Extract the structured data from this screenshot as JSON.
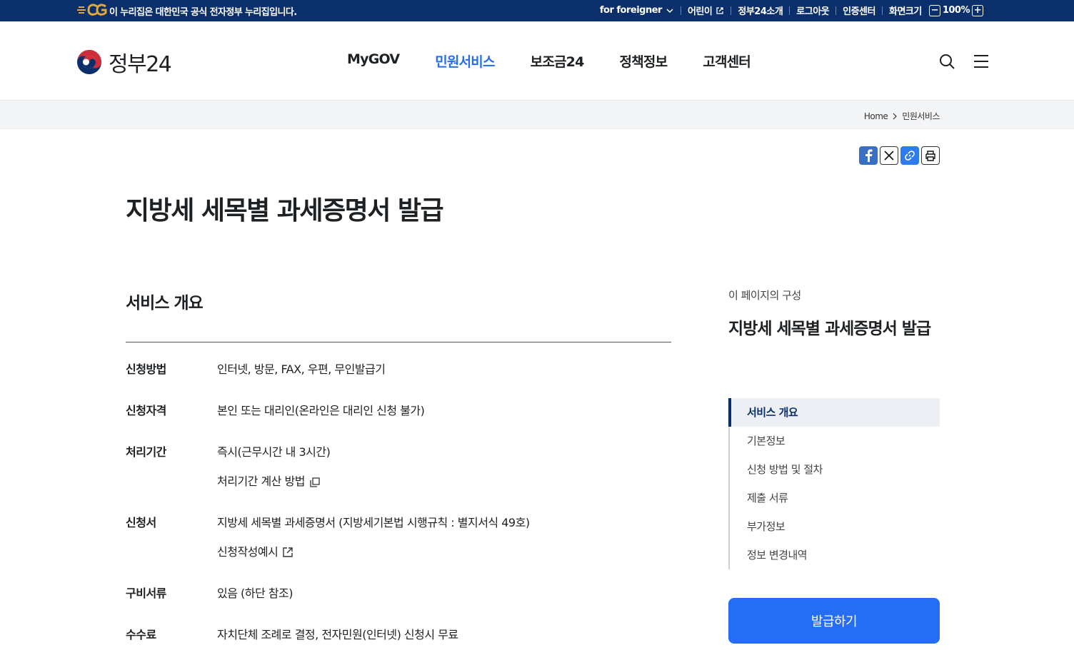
{
  "topbar": {
    "notice": "이 누리집은 대한민국 공식 전자정부 누리집입니다.",
    "links": {
      "foreigner": "for foreigner",
      "kids": "어린이",
      "about": "정부24소개",
      "logout": "로그아웃",
      "cert": "인증센터",
      "zoom_label": "화면크기",
      "zoom_value": "100%"
    }
  },
  "header": {
    "logo_text": "정부24",
    "nav": [
      "MyGOV",
      "민원서비스",
      "보조금24",
      "정책정보",
      "고객센터"
    ],
    "active_nav": "민원서비스"
  },
  "breadcrumb": [
    "Home",
    "민원서비스"
  ],
  "page": {
    "title": "지방세 세목별 과세증명서 발급"
  },
  "overview": {
    "title": "서비스 개요",
    "rows": [
      {
        "label": "신청방법",
        "lines": [
          "인터넷, 방문, FAX, 우편, 무인발급기"
        ]
      },
      {
        "label": "신청자격",
        "lines": [
          "본인 또는 대리인(온라인은 대리인 신청 불가)"
        ]
      },
      {
        "label": "처리기간",
        "lines": [
          "즉시(근무시간 내 3시간)",
          "처리기간 계산 방법"
        ]
      },
      {
        "label": "신청서",
        "lines": [
          "지방세 세목별 과세증명서 (지방세기본법 시행규칙 : 별지서식 49호)",
          "신청작성예시"
        ]
      },
      {
        "label": "구비서류",
        "lines": [
          "있음 (하단 참조)"
        ]
      },
      {
        "label": "수수료",
        "lines": [
          "자치단체 조례로 결정, 전자민원(인터넷) 신청시 무료"
        ]
      }
    ]
  },
  "toc": {
    "caption": "이 페이지의 구성",
    "title": "지방세 세목별 과세증명서 발급",
    "items": [
      "서비스 개요",
      "기본정보",
      "신청 방법 및 절차",
      "제출 서류",
      "부가정보",
      "정보 변경내역"
    ],
    "active": 0
  },
  "cta": {
    "issue": "발급하기"
  },
  "colors": {
    "brand_navy": "#0b2f6b",
    "accent_blue": "#256ef4"
  }
}
